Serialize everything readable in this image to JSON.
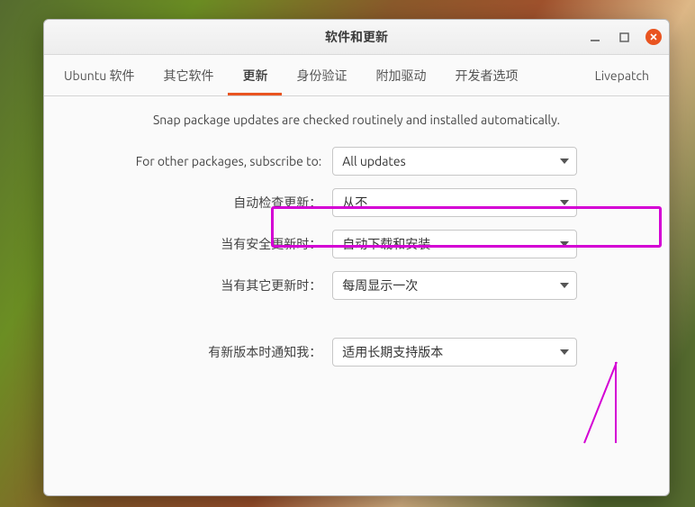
{
  "window": {
    "title": "软件和更新"
  },
  "tabs": {
    "items": [
      {
        "label": "Ubuntu 软件"
      },
      {
        "label": "其它软件"
      },
      {
        "label": "更新"
      },
      {
        "label": "身份验证"
      },
      {
        "label": "附加驱动"
      },
      {
        "label": "开发者选项"
      },
      {
        "label": "Livepatch"
      }
    ],
    "active_index": 2
  },
  "content": {
    "note": "Snap package updates are checked routinely and installed automatically.",
    "rows": [
      {
        "label": "For other packages, subscribe to:",
        "value": "All updates"
      },
      {
        "label": "自动检查更新：",
        "value": "从不"
      },
      {
        "label": "当有安全更新时：",
        "value": "自动下载和安装"
      },
      {
        "label": "当有其它更新时：",
        "value": "每周显示一次"
      },
      {
        "label": "有新版本时通知我：",
        "value": "适用长期支持版本"
      }
    ]
  },
  "colors": {
    "accent": "#e95420",
    "highlight": "#d400d4"
  }
}
